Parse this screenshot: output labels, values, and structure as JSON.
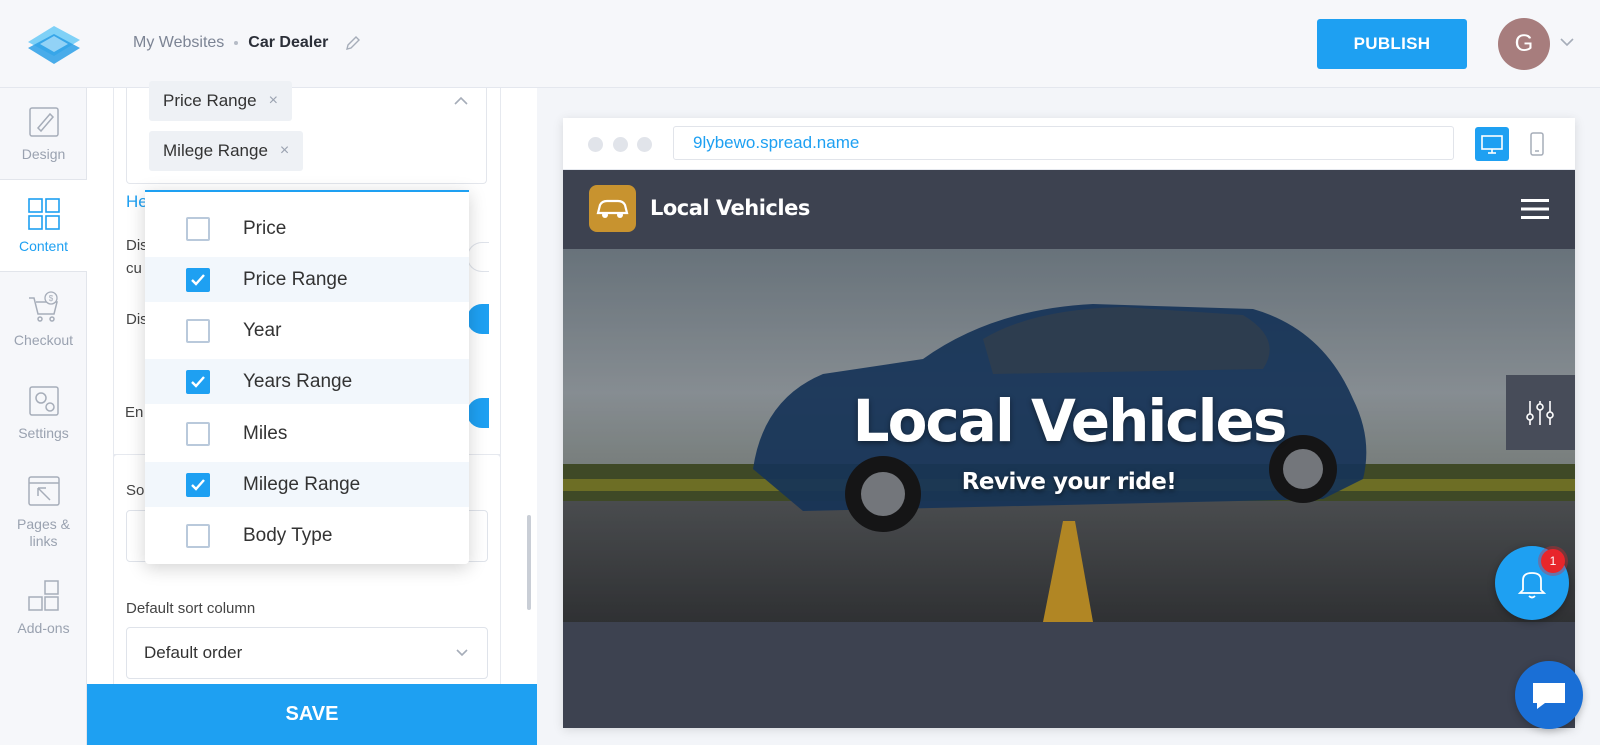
{
  "breadcrumb": {
    "parent": "My Websites",
    "current": "Car Dealer"
  },
  "header": {
    "publish_label": "PUBLISH",
    "avatar_initial": "G"
  },
  "nav": {
    "design": "Design",
    "content": "Content",
    "checkout": "Checkout",
    "settings": "Settings",
    "pages_links": "Pages & links",
    "addons": "Add-ons"
  },
  "panel": {
    "chips": [
      "Price Range",
      "Milege Range"
    ],
    "chip_remove": "×",
    "help_fragment": "He",
    "label_dis_1": "Dis",
    "label_cu": "cu",
    "label_dis_2": "Dis",
    "label_en": "En",
    "label_so": "So",
    "default_sort_label": "Default sort column",
    "default_sort_value": "Default order",
    "save_label": "SAVE"
  },
  "dropdown": {
    "options": [
      {
        "label": "Price",
        "checked": false
      },
      {
        "label": "Price Range",
        "checked": true
      },
      {
        "label": "Year",
        "checked": false
      },
      {
        "label": "Years Range",
        "checked": true
      },
      {
        "label": "Miles",
        "checked": false
      },
      {
        "label": "Milege Range",
        "checked": true
      },
      {
        "label": "Body Type",
        "checked": false
      }
    ]
  },
  "preview": {
    "url": "9lybewo.spread.name",
    "site_name": "Local Vehicles",
    "hero_title": "Local Vehicles",
    "hero_subtitle": "Revive your ride!",
    "notification_count": "1"
  },
  "colors": {
    "accent": "#1ea0f2",
    "site_bg": "#3d4250",
    "logo_bg": "#c8932f",
    "badge": "#e8262b"
  }
}
